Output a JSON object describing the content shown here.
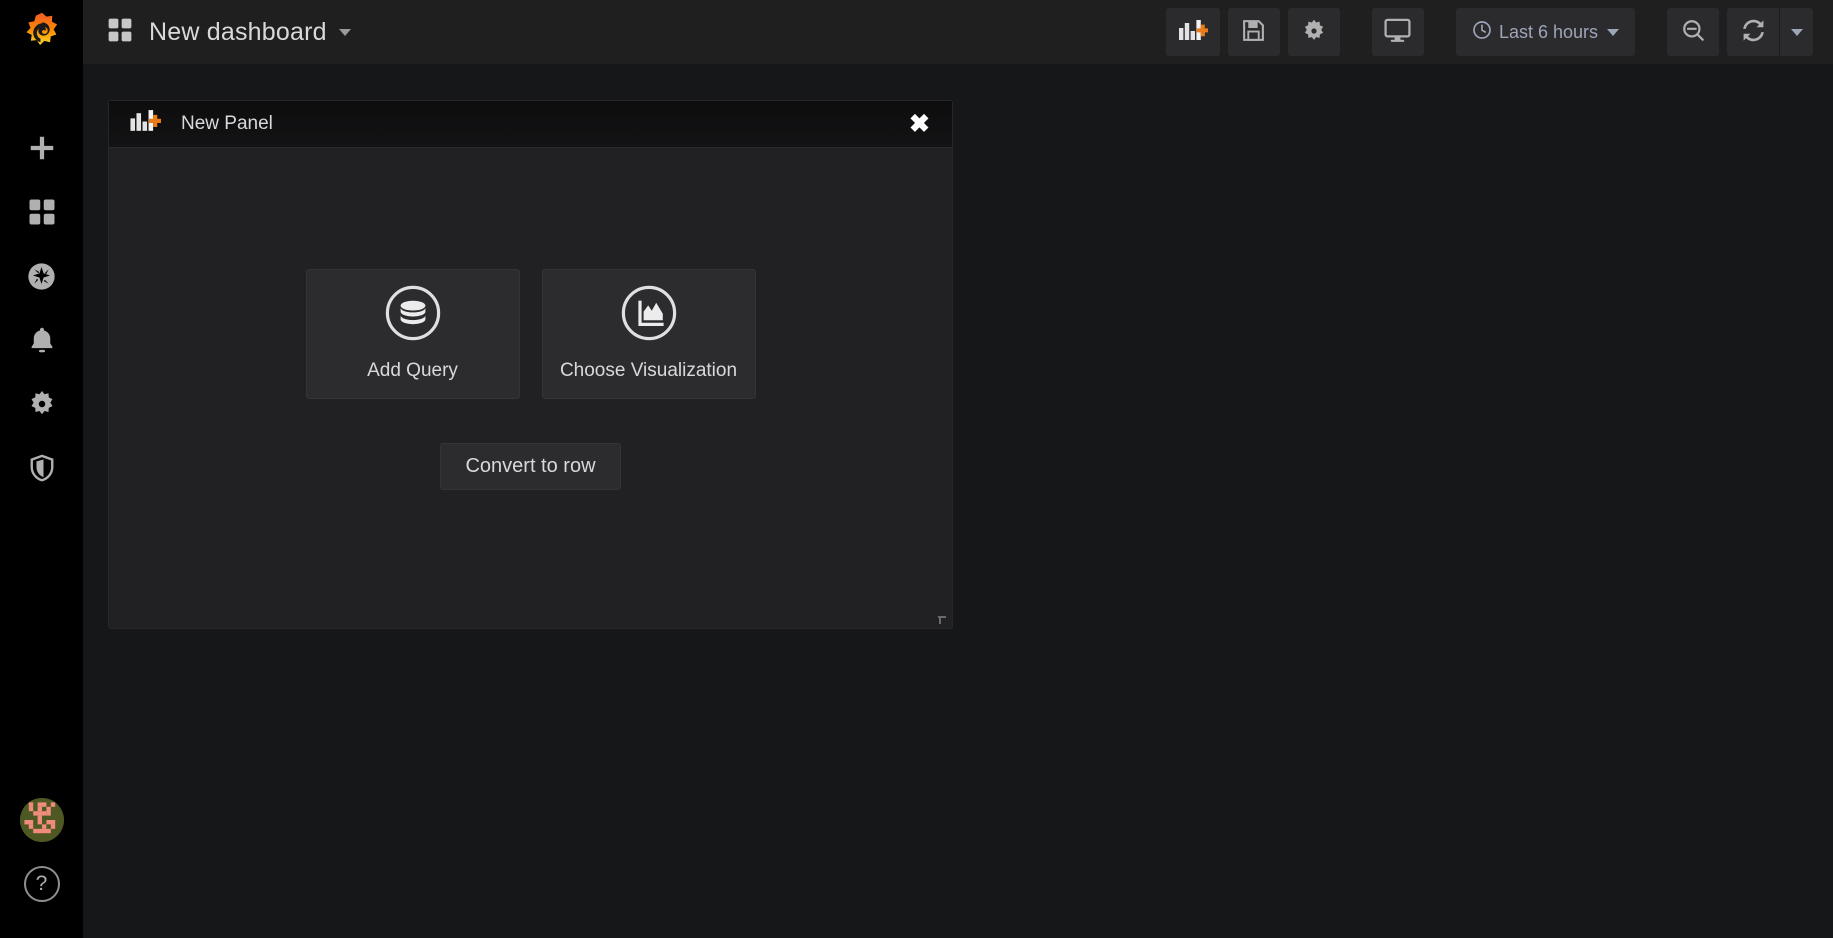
{
  "app": {
    "brand_icon": "grafana-logo",
    "background_color": "#161719",
    "accent_color": "#eb7b18"
  },
  "sidebar": {
    "brand_label": "Grafana",
    "items": [
      {
        "icon": "plus-icon",
        "label": "Create",
        "name": "sidebar-item-create"
      },
      {
        "icon": "dashboards-icon",
        "label": "Dashboards",
        "name": "sidebar-item-dashboards"
      },
      {
        "icon": "compass-icon",
        "label": "Explore",
        "name": "sidebar-item-explore"
      },
      {
        "icon": "bell-icon",
        "label": "Alerting",
        "name": "sidebar-item-alerting"
      },
      {
        "icon": "gear-icon",
        "label": "Configuration",
        "name": "sidebar-item-configuration"
      },
      {
        "icon": "shield-icon",
        "label": "Server Admin",
        "name": "sidebar-item-server-admin"
      }
    ],
    "bottom": {
      "avatar_label": "User profile",
      "help_label": "?"
    }
  },
  "navbar": {
    "dashboard_icon": "dashboard-grid-icon",
    "title": "New dashboard",
    "title_caret": "caret-down-icon",
    "actions": [
      {
        "name": "add-panel-button",
        "icon": "add-panel-icon",
        "label": "Add panel"
      },
      {
        "name": "save-dashboard-button",
        "icon": "save-icon",
        "label": "Save dashboard"
      },
      {
        "name": "dashboard-settings-button",
        "icon": "gear-icon",
        "label": "Dashboard settings"
      },
      {
        "name": "cycle-view-mode-button",
        "icon": "monitor-icon",
        "label": "Cycle view mode"
      }
    ],
    "time_picker": {
      "icon": "clock-icon",
      "value": "Last 6 hours",
      "caret": "caret-down-icon"
    },
    "zoom_out": {
      "name": "zoom-out-button",
      "icon": "search-minus-icon",
      "label": "Zoom out time range"
    },
    "refresh": {
      "name": "refresh-button",
      "icon": "refresh-icon",
      "label": "Refresh dashboard"
    },
    "refresh_interval_caret": {
      "name": "refresh-interval-dropdown",
      "icon": "caret-down-icon"
    }
  },
  "panel": {
    "header_icon": "add-panel-icon",
    "title": "New Panel",
    "close_label": "✖",
    "cards": [
      {
        "name": "add-query-card",
        "icon": "database-icon",
        "label": "Add Query"
      },
      {
        "name": "choose-visualization-card",
        "icon": "area-chart-icon",
        "label": "Choose Visualization"
      }
    ],
    "convert_to_row_label": "Convert to row",
    "resize_handle": "resize-handle-icon"
  }
}
